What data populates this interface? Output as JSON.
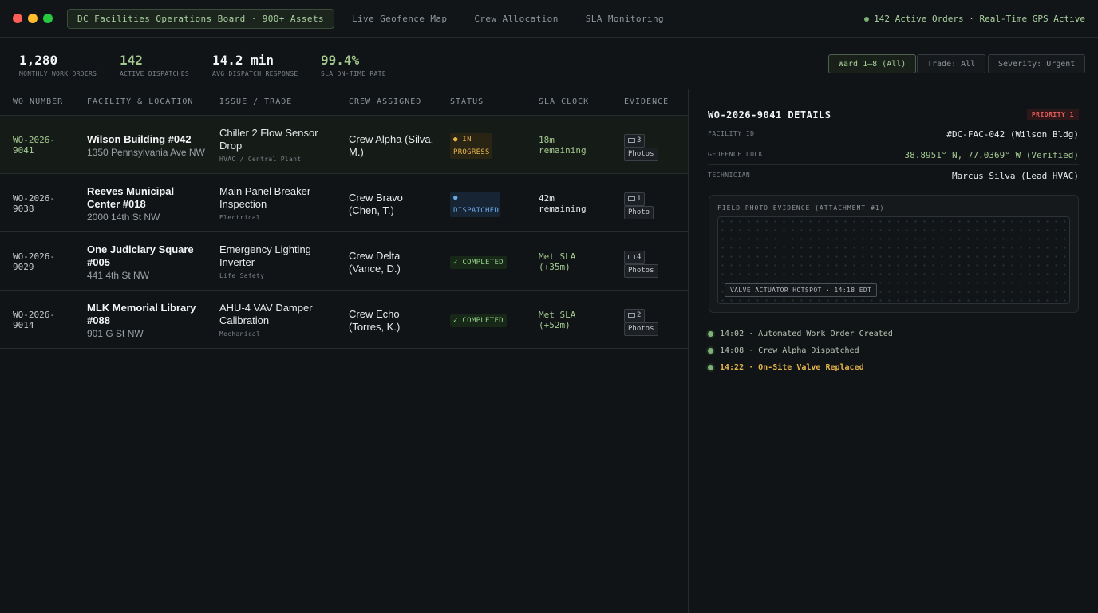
{
  "window": {
    "tabs": [
      {
        "label": "DC Facilities Operations Board · 900+ Assets",
        "active": true
      },
      {
        "label": "Live Geofence Map",
        "active": false
      },
      {
        "label": "Crew Allocation",
        "active": false
      },
      {
        "label": "SLA Monitoring",
        "active": false
      }
    ],
    "status": "142 Active Orders · Real-Time GPS Active"
  },
  "stats": [
    {
      "value": "1,280",
      "label": "Monthly Work Orders"
    },
    {
      "value": "142",
      "label": "Active Dispatches"
    },
    {
      "value": "14.2 min",
      "label": "Avg Dispatch Response"
    },
    {
      "value": "99.4%",
      "label": "SLA On-Time Rate"
    }
  ],
  "filters": [
    {
      "label": "Ward 1–8 (All)",
      "active": true
    },
    {
      "label": "Trade: All",
      "active": false
    },
    {
      "label": "Severity: Urgent",
      "active": false
    }
  ],
  "table": {
    "headers": [
      "WO Number",
      "Facility & Location",
      "Issue / Trade",
      "Crew Assigned",
      "Status",
      "SLA Clock",
      "Evidence"
    ],
    "rows": [
      {
        "wo": "WO-2026-9041",
        "facility": "Wilson Building #042",
        "address": "1350 Pennsylvania Ave NW",
        "issue": "Chiller 2 Flow Sensor Drop",
        "trade": "HVAC / Central Plant",
        "crew": "Crew Alpha (Silva, M.)",
        "status": "● IN PROGRESS",
        "sla": "18m remaining",
        "evidence_count": "3",
        "evidence_unit": "Photos"
      },
      {
        "wo": "WO-2026-9038",
        "facility": "Reeves Municipal Center #018",
        "address": "2000 14th St NW",
        "issue": "Main Panel Breaker Inspection",
        "trade": "Electrical",
        "crew": "Crew Bravo (Chen, T.)",
        "status": "● DISPATCHED",
        "sla": "42m remaining",
        "evidence_count": "1",
        "evidence_unit": "Photo"
      },
      {
        "wo": "WO-2026-9029",
        "facility": "One Judiciary Square #005",
        "address": "441 4th St NW",
        "issue": "Emergency Lighting Inverter",
        "trade": "Life Safety",
        "crew": "Crew Delta (Vance, D.)",
        "status": "✓ COMPLETED",
        "sla": "Met SLA (+35m)",
        "evidence_count": "4",
        "evidence_unit": "Photos"
      },
      {
        "wo": "WO-2026-9014",
        "facility": "MLK Memorial Library #088",
        "address": "901 G St NW",
        "issue": "AHU-4 VAV Damper Calibration",
        "trade": "Mechanical",
        "crew": "Crew Echo (Torres, K.)",
        "status": "✓ COMPLETED",
        "sla": "Met SLA (+52m)",
        "evidence_count": "2",
        "evidence_unit": "Photos"
      }
    ]
  },
  "detail": {
    "title": "WO-2026-9041 DETAILS",
    "priority": "PRIORITY 1",
    "fields": [
      {
        "key": "FACILITY ID",
        "value": "#DC-FAC-042 (Wilson Bldg)"
      },
      {
        "key": "GEOFENCE LOCK",
        "value": "38.8951° N, 77.0369° W (Verified)"
      },
      {
        "key": "TECHNICIAN",
        "value": "Marcus Silva (Lead HVAC)"
      }
    ],
    "photo_label": "FIELD PHOTO EVIDENCE (ATTACHMENT #1)",
    "hotspot": "VALVE ACTUATOR HOTSPOT · 14:18 EDT",
    "timeline": [
      {
        "text": "14:02 · Automated Work Order Created"
      },
      {
        "text": "14:08 · Crew Alpha Dispatched"
      },
      {
        "text": "14:22 · On-Site Valve Replaced"
      }
    ]
  }
}
